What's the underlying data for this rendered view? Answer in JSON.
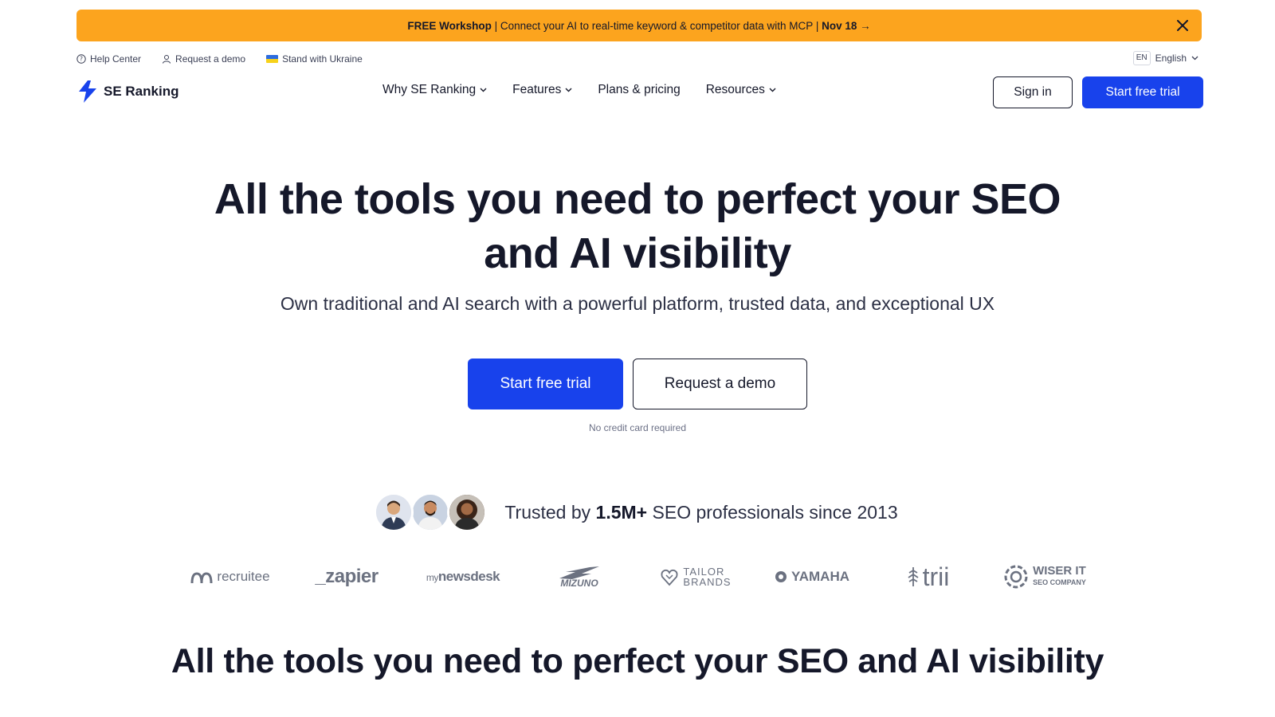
{
  "promo": {
    "bold_lead": "FREE Workshop",
    "text": " | Connect your AI to real-time keyword & competitor data with MCP | ",
    "date": "Nov 18 →",
    "close_icon": "close-icon"
  },
  "utility": {
    "help": "Help Center",
    "demo": "Request a demo",
    "ukraine": "Stand with Ukraine",
    "lang_code": "EN",
    "lang_label": "English"
  },
  "header": {
    "logo_text": "SE Ranking",
    "nav": [
      {
        "label": "Why SE Ranking",
        "has_dropdown": true
      },
      {
        "label": "Features",
        "has_dropdown": true
      },
      {
        "label": "Plans & pricing",
        "has_dropdown": false
      },
      {
        "label": "Resources",
        "has_dropdown": true
      }
    ],
    "signin": "Sign in",
    "trial": "Start free trial"
  },
  "hero": {
    "title_line1": "All the tools you need to perfect your SEO",
    "title_line2": "and AI visibility",
    "subtitle": "Own traditional and AI search with a powerful platform, trusted data, and exceptional UX",
    "cta_primary": "Start free trial",
    "cta_secondary": "Request a demo",
    "note": "No credit card required"
  },
  "trusted": {
    "prefix": "Trusted by ",
    "count": "1.5M+",
    "suffix": " SEO professionals since 2013"
  },
  "logos": {
    "recruitee": "recruitee",
    "zapier": "_zapier",
    "newsdesk_my": "my",
    "newsdesk": "newsdesk",
    "mizuno": "MIZUNO",
    "tailor_1": "TAILOR",
    "tailor_2": "BRANDS",
    "yamaha": "YAMAHA",
    "trii": "trii",
    "wiser": "WISER IT",
    "wiser_sub": "SEO COMPANY"
  },
  "section": {
    "title": "All the tools you need to perfect your SEO and AI visibility"
  },
  "colors": {
    "promo_bg": "#fca41e",
    "primary": "#1842ec",
    "text": "#15182a",
    "logo_grey": "#6b7180"
  }
}
